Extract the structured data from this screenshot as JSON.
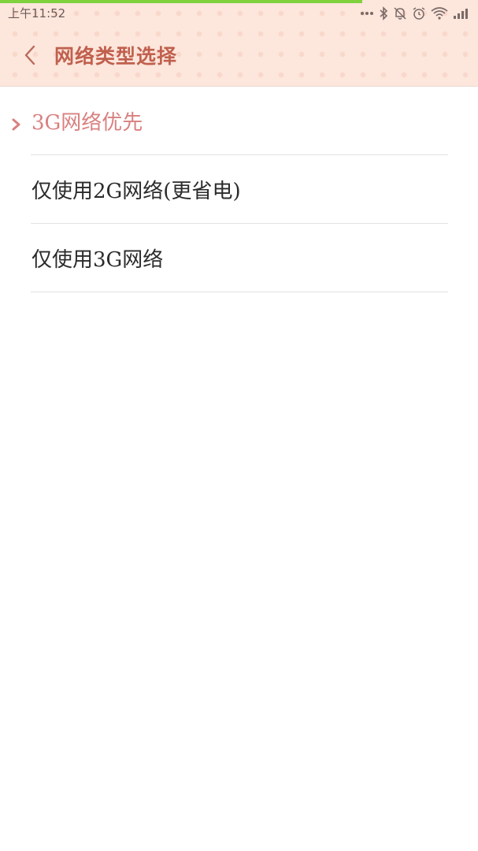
{
  "status_bar": {
    "time": "上午11:52",
    "icons": [
      "more-dots-icon",
      "bluetooth-icon",
      "notifications-off-icon",
      "alarm-icon",
      "wifi-icon",
      "signal-icon"
    ]
  },
  "header": {
    "title": "网络类型选择",
    "back_icon": "chevron-left-icon",
    "accent_color": "#c0604e",
    "background_color": "#fde6dc"
  },
  "options": [
    {
      "label": "3G网络优先",
      "selected": true
    },
    {
      "label": "仅使用2G网络(更省电)",
      "selected": false
    },
    {
      "label": "仅使用3G网络",
      "selected": false
    }
  ],
  "colors": {
    "selected_text": "#d98080",
    "normal_text": "#2b2b2b",
    "progress_bar": "#7fd23c"
  }
}
